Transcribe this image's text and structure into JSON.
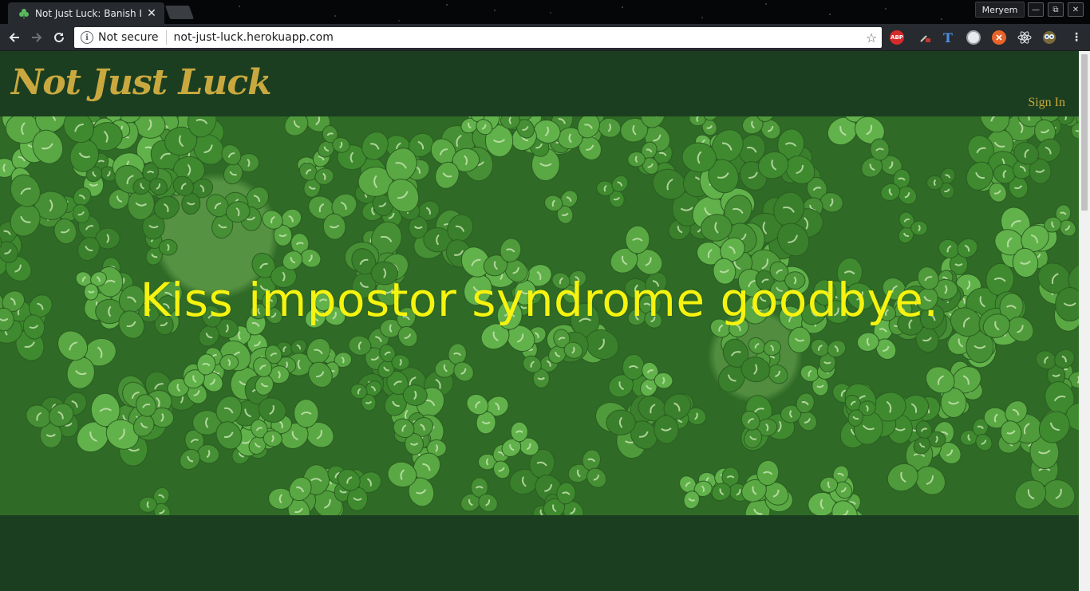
{
  "browser": {
    "tab": {
      "title": "Not Just Luck: Banish Im",
      "close_glyph": "✕"
    },
    "profile_name": "Meryem",
    "address_bar": {
      "security_label": "Not secure",
      "url": "not-just-luck.herokuapp.com"
    },
    "window_controls": [
      "—",
      "⧉",
      "✕"
    ],
    "extensions": [
      {
        "icon": "adblock-plus-icon",
        "label": "ABP",
        "color": "#d62b2b"
      },
      {
        "icon": "eyedropper-icon",
        "label": "",
        "color": "#3a3d42"
      },
      {
        "icon": "tampermonkey-icon",
        "label": "T",
        "color": "#1f5fbf"
      },
      {
        "icon": "white-circle-icon",
        "label": "",
        "color": "#e8eaed"
      },
      {
        "icon": "orange-extension-icon",
        "label": "",
        "color": "#e8632a"
      },
      {
        "icon": "react-devtools-icon",
        "label": "",
        "color": "#3a3d42"
      },
      {
        "icon": "owl-extension-icon",
        "label": "",
        "color": "#3a3d42"
      }
    ]
  },
  "site": {
    "logo_text": "Not Just Luck",
    "signin_label": "Sign In",
    "hero_heading": "Kiss impostor syndrome goodbye."
  },
  "colors": {
    "header_bg": "#1b3e20",
    "logo_gold": "#c9a93f",
    "hero_text": "#f6f30f",
    "clover_green": "#4f9a3a"
  }
}
